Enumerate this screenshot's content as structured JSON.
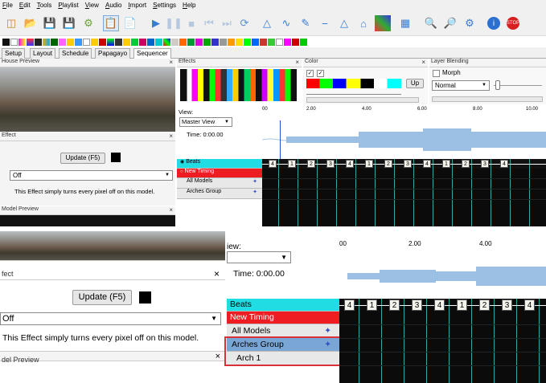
{
  "menu": [
    "File",
    "Edit",
    "Tools",
    "Playlist",
    "View",
    "Audio",
    "Import",
    "Settings",
    "Help"
  ],
  "tabs": [
    "Setup",
    "Layout",
    "Schedule",
    "Papagayo",
    "Sequencer"
  ],
  "active_tab": "Sequencer",
  "panels": {
    "house_preview": "House Preview",
    "effects": "Effects",
    "color": "Color",
    "layer_blending": "Layer Blending",
    "effect": "Effect",
    "model_preview": "Model Preview"
  },
  "layer_blending": {
    "morph_label": "Morph",
    "mode": "Normal"
  },
  "color_button": "Up",
  "effect_panel": {
    "update_button": "Update (F5)",
    "effect_select": "Off",
    "description": "This Effect simply turns every pixel off on this model."
  },
  "timeline": {
    "view_label": "View:",
    "view_select": "Master View",
    "time_label": "Time: 0:00.00",
    "ticks": [
      "00",
      "2.00",
      "4.00",
      "6.00",
      "8.00",
      "10.00"
    ],
    "timing_labels": [
      "4",
      "1",
      "2",
      "3",
      "4",
      "1",
      "2",
      "3",
      "4",
      "1",
      "2",
      "3",
      "4"
    ]
  },
  "rows": [
    {
      "label": "Beats",
      "bg": "#1fdde3"
    },
    {
      "label": "New Timing",
      "bg": "#ee1d22"
    },
    {
      "label": "All Models",
      "bg": "#e8e8e8"
    },
    {
      "label": "Arches Group",
      "bg": "#e8e8e8"
    }
  ],
  "zoom": {
    "effect_title": "fect",
    "view_label": "iew:",
    "time_label": "Time: 0:00.00",
    "ticks": [
      "00",
      "2.00",
      "4.00"
    ],
    "update_button": "Update (F5)",
    "effect_select": "Off",
    "description": "This Effect simply turns every pixel off on this model.",
    "model_preview": "del Preview",
    "rows": [
      "Beats",
      "New Timing",
      "All Models",
      "Arches Group",
      "Arch 1"
    ],
    "timing_labels": [
      "4",
      "1",
      "2",
      "3",
      "4",
      "1",
      "2",
      "3",
      "4"
    ]
  },
  "colors": {
    "beats": "#1fdde3",
    "new_timing": "#ee1d22",
    "highlight": "#d9313a",
    "selected_row": "#7aa6d6"
  }
}
